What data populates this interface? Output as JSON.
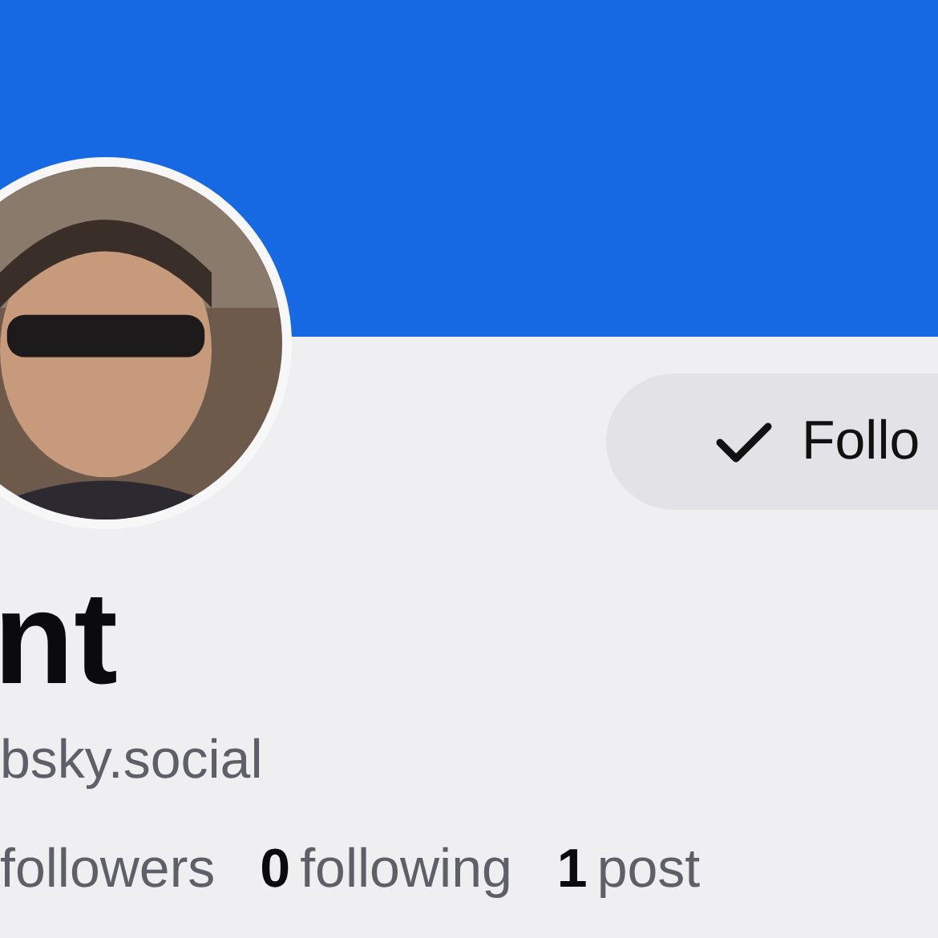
{
  "follow_button": {
    "label": "Follo",
    "following": true
  },
  "profile": {
    "display_name": "nt",
    "handle": "bsky.social"
  },
  "stats": [
    {
      "label": "followers"
    },
    {
      "count": "0",
      "label": "following"
    },
    {
      "count": "1",
      "label": "post"
    }
  ]
}
